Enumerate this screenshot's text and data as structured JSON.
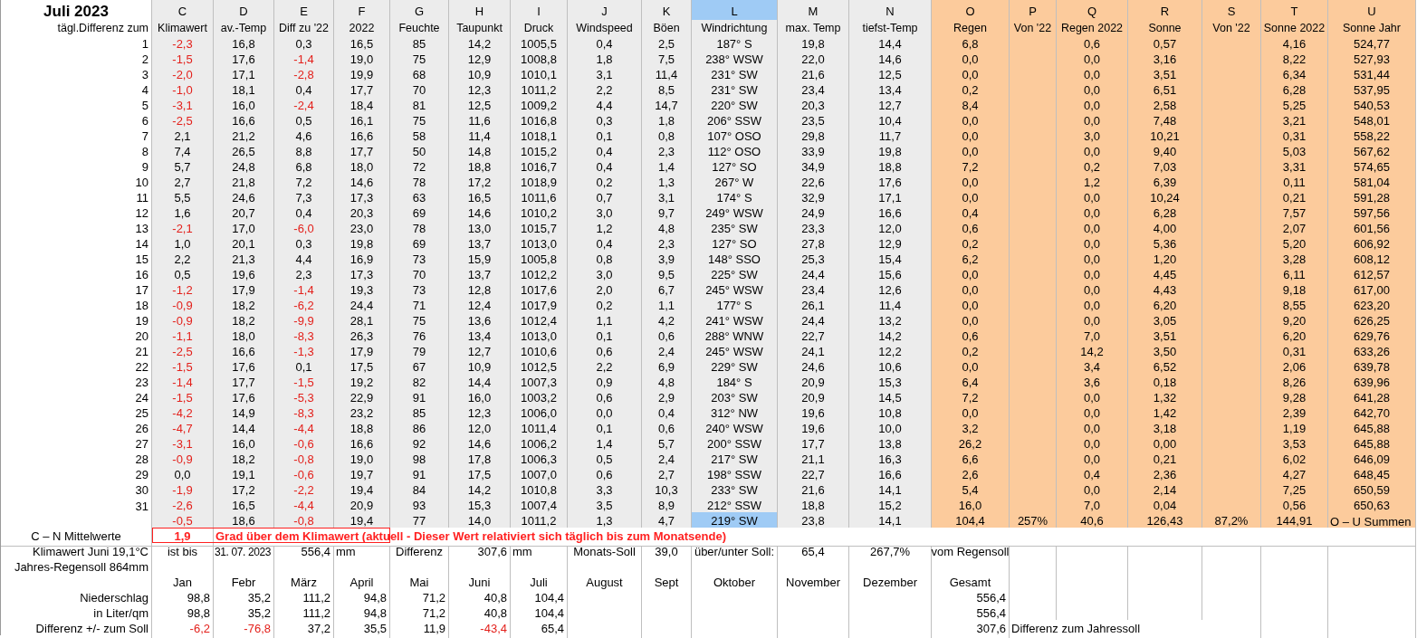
{
  "sheet": {
    "title": "Juli 2023",
    "row_label": "tägl.Differenz zum",
    "columns": [
      {
        "letter": "C",
        "label": "Klimawert",
        "color": "#ececec",
        "selected": false
      },
      {
        "letter": "D",
        "label": "av.-Temp",
        "color": "#ececec",
        "selected": false
      },
      {
        "letter": "E",
        "label": "Diff zu '22",
        "color": "#ececec",
        "selected": false
      },
      {
        "letter": "F",
        "label": "2022",
        "color": "#ececec",
        "selected": false
      },
      {
        "letter": "G",
        "label": "Feuchte",
        "color": "#ececec",
        "selected": false
      },
      {
        "letter": "H",
        "label": "Taupunkt",
        "color": "#ececec",
        "selected": false
      },
      {
        "letter": "I",
        "label": "Druck",
        "color": "#ececec",
        "selected": false
      },
      {
        "letter": "J",
        "label": "Windspeed",
        "color": "#ececec",
        "selected": false
      },
      {
        "letter": "K",
        "label": "Böen",
        "color": "#ececec",
        "selected": false
      },
      {
        "letter": "L",
        "label": "Windrichtung",
        "color": "#ececec",
        "selected": true
      },
      {
        "letter": "M",
        "label": "max. Temp",
        "color": "#ececec",
        "selected": false
      },
      {
        "letter": "N",
        "label": "tiefst-Temp",
        "color": "#ececec",
        "selected": false
      },
      {
        "letter": "O",
        "label": "Regen",
        "color": "#fccb9c",
        "selected": false
      },
      {
        "letter": "P",
        "label": "Von '22",
        "color": "#fccb9c",
        "selected": false
      },
      {
        "letter": "Q",
        "label": "Regen 2022",
        "color": "#fccb9c",
        "selected": false
      },
      {
        "letter": "R",
        "label": "Sonne",
        "color": "#fccb9c",
        "selected": false
      },
      {
        "letter": "S",
        "label": "Von '22",
        "color": "#fccb9c",
        "selected": false
      },
      {
        "letter": "T",
        "label": "Sonne 2022",
        "color": "#fccb9c",
        "selected": false
      },
      {
        "letter": "U",
        "label": "Sonne Jahr",
        "color": "#fccb9c",
        "selected": false
      }
    ],
    "rows": [
      {
        "day": "1",
        "cells": [
          {
            "text": "-2,3",
            "red": true
          },
          "16,8",
          "0,3",
          "16,5",
          "85",
          "14,2",
          "1005,5",
          "0,4",
          "2,5",
          "187° S",
          "19,8",
          "14,4",
          "6,8",
          null,
          "0,6",
          "0,57",
          null,
          "4,16",
          "524,77"
        ]
      },
      {
        "day": "2",
        "cells": [
          {
            "text": "-1,5",
            "red": true
          },
          "17,6",
          {
            "text": "-1,4",
            "red": true
          },
          "19,0",
          "75",
          "12,9",
          "1008,8",
          "1,8",
          "7,5",
          "238° WSW",
          "22,0",
          "14,6",
          "0,0",
          null,
          "0,0",
          "3,16",
          null,
          "8,22",
          "527,93"
        ]
      },
      {
        "day": "3",
        "cells": [
          {
            "text": "-2,0",
            "red": true
          },
          "17,1",
          {
            "text": "-2,8",
            "red": true
          },
          "19,9",
          "68",
          "10,9",
          "1010,1",
          "3,1",
          "11,4",
          "231° SW",
          "21,6",
          "12,5",
          "0,0",
          null,
          "0,0",
          "3,51",
          null,
          "6,34",
          "531,44"
        ]
      },
      {
        "day": "4",
        "cells": [
          {
            "text": "-1,0",
            "red": true
          },
          "18,1",
          "0,4",
          "17,7",
          "70",
          "12,3",
          "1011,2",
          "2,2",
          "8,5",
          "231° SW",
          "23,4",
          "13,4",
          "0,2",
          null,
          "0,0",
          "6,51",
          null,
          "6,28",
          "537,95"
        ]
      },
      {
        "day": "5",
        "cells": [
          {
            "text": "-3,1",
            "red": true
          },
          "16,0",
          {
            "text": "-2,4",
            "red": true
          },
          "18,4",
          "81",
          "12,5",
          "1009,2",
          "4,4",
          "14,7",
          "220° SW",
          "20,3",
          "12,7",
          "8,4",
          null,
          "0,0",
          "2,58",
          null,
          "5,25",
          "540,53"
        ]
      },
      {
        "day": "6",
        "cells": [
          {
            "text": "-2,5",
            "red": true
          },
          "16,6",
          "0,5",
          "16,1",
          "75",
          "11,6",
          "1016,8",
          "0,3",
          "1,8",
          "206° SSW",
          "23,5",
          "10,4",
          "0,0",
          null,
          "0,0",
          "7,48",
          null,
          "3,21",
          "548,01"
        ]
      },
      {
        "day": "7",
        "cells": [
          "2,1",
          "21,2",
          "4,6",
          "16,6",
          "58",
          "11,4",
          "1018,1",
          "0,1",
          "0,8",
          "107° OSO",
          "29,8",
          "11,7",
          "0,0",
          null,
          "3,0",
          "10,21",
          null,
          "0,31",
          "558,22"
        ]
      },
      {
        "day": "8",
        "cells": [
          "7,4",
          "26,5",
          "8,8",
          "17,7",
          "50",
          "14,8",
          "1015,2",
          "0,4",
          "2,3",
          "112° OSO",
          "33,9",
          "19,8",
          "0,0",
          null,
          "0,0",
          "9,40",
          null,
          "5,03",
          "567,62"
        ]
      },
      {
        "day": "9",
        "cells": [
          "5,7",
          "24,8",
          "6,8",
          "18,0",
          "72",
          "18,8",
          "1016,7",
          "0,4",
          "1,4",
          "127° SO",
          "34,9",
          "18,8",
          "7,2",
          null,
          "0,2",
          "7,03",
          null,
          "3,31",
          "574,65"
        ]
      },
      {
        "day": "10",
        "cells": [
          "2,7",
          "21,8",
          "7,2",
          "14,6",
          "78",
          "17,2",
          "1018,9",
          "0,2",
          "1,3",
          "267° W",
          "22,6",
          "17,6",
          "0,0",
          null,
          "1,2",
          "6,39",
          null,
          "0,11",
          "581,04"
        ]
      },
      {
        "day": "11",
        "cells": [
          "5,5",
          "24,6",
          "7,3",
          "17,3",
          "63",
          "16,5",
          "1011,6",
          "0,7",
          "3,1",
          "174° S",
          "32,9",
          "17,1",
          "0,0",
          null,
          "0,0",
          "10,24",
          null,
          "0,21",
          "591,28"
        ]
      },
      {
        "day": "12",
        "cells": [
          "1,6",
          "20,7",
          "0,4",
          "20,3",
          "69",
          "14,6",
          "1010,2",
          "3,0",
          "9,7",
          "249° WSW",
          "24,9",
          "16,6",
          "0,4",
          null,
          "0,0",
          "6,28",
          null,
          "7,57",
          "597,56"
        ]
      },
      {
        "day": "13",
        "cells": [
          {
            "text": "-2,1",
            "red": true
          },
          "17,0",
          {
            "text": "-6,0",
            "red": true
          },
          "23,0",
          "78",
          "13,0",
          "1015,7",
          "1,2",
          "4,8",
          "235° SW",
          "23,3",
          "12,0",
          "0,6",
          null,
          "0,0",
          "4,00",
          null,
          "2,07",
          "601,56"
        ]
      },
      {
        "day": "14",
        "cells": [
          "1,0",
          "20,1",
          "0,3",
          "19,8",
          "69",
          "13,7",
          "1013,0",
          "0,4",
          "2,3",
          "127° SO",
          "27,8",
          "12,9",
          "0,2",
          null,
          "0,0",
          "5,36",
          null,
          "5,20",
          "606,92"
        ]
      },
      {
        "day": "15",
        "cells": [
          "2,2",
          "21,3",
          "4,4",
          "16,9",
          "73",
          "15,9",
          "1005,8",
          "0,8",
          "3,9",
          "148° SSO",
          "25,3",
          "15,4",
          "6,2",
          null,
          "0,0",
          "1,20",
          null,
          "3,28",
          "608,12"
        ]
      },
      {
        "day": "16",
        "cells": [
          "0,5",
          "19,6",
          "2,3",
          "17,3",
          "70",
          "13,7",
          "1012,2",
          "3,0",
          "9,5",
          "225° SW",
          "24,4",
          "15,6",
          "0,0",
          null,
          "0,0",
          "4,45",
          null,
          "6,11",
          "612,57"
        ]
      },
      {
        "day": "17",
        "cells": [
          {
            "text": "-1,2",
            "red": true
          },
          "17,9",
          {
            "text": "-1,4",
            "red": true
          },
          "19,3",
          "73",
          "12,8",
          "1017,6",
          "2,0",
          "6,7",
          "245° WSW",
          "23,4",
          "12,6",
          "0,0",
          null,
          "0,0",
          "4,43",
          null,
          "9,18",
          "617,00"
        ]
      },
      {
        "day": "18",
        "cells": [
          {
            "text": "-0,9",
            "red": true
          },
          "18,2",
          {
            "text": "-6,2",
            "red": true
          },
          "24,4",
          "71",
          "12,4",
          "1017,9",
          "0,2",
          "1,1",
          "177° S",
          "26,1",
          "11,4",
          "0,0",
          null,
          "0,0",
          "6,20",
          null,
          "8,55",
          "623,20"
        ]
      },
      {
        "day": "19",
        "cells": [
          {
            "text": "-0,9",
            "red": true
          },
          "18,2",
          {
            "text": "-9,9",
            "red": true
          },
          "28,1",
          "75",
          "13,6",
          "1012,4",
          "1,1",
          "4,2",
          "241° WSW",
          "24,4",
          "13,2",
          "0,0",
          null,
          "0,0",
          "3,05",
          null,
          "9,20",
          "626,25"
        ]
      },
      {
        "day": "20",
        "cells": [
          {
            "text": "-1,1",
            "red": true
          },
          "18,0",
          {
            "text": "-8,3",
            "red": true
          },
          "26,3",
          "76",
          "13,4",
          "1013,0",
          "0,1",
          "0,6",
          "288° WNW",
          "22,7",
          "14,2",
          "0,6",
          null,
          "7,0",
          "3,51",
          null,
          "6,20",
          "629,76"
        ]
      },
      {
        "day": "21",
        "cells": [
          {
            "text": "-2,5",
            "red": true
          },
          "16,6",
          {
            "text": "-1,3",
            "red": true
          },
          "17,9",
          "79",
          "12,7",
          "1010,6",
          "0,6",
          "2,4",
          "245° WSW",
          "24,1",
          "12,2",
          "0,2",
          null,
          "14,2",
          "3,50",
          null,
          "0,31",
          "633,26"
        ]
      },
      {
        "day": "22",
        "cells": [
          {
            "text": "-1,5",
            "red": true
          },
          "17,6",
          "0,1",
          "17,5",
          "67",
          "10,9",
          "1012,5",
          "2,2",
          "6,9",
          "229° SW",
          "24,6",
          "10,6",
          "0,0",
          null,
          "3,4",
          "6,52",
          null,
          "2,06",
          "639,78"
        ]
      },
      {
        "day": "23",
        "cells": [
          {
            "text": "-1,4",
            "red": true
          },
          "17,7",
          {
            "text": "-1,5",
            "red": true
          },
          "19,2",
          "82",
          "14,4",
          "1007,3",
          "0,9",
          "4,8",
          "184° S",
          "20,9",
          "15,3",
          "6,4",
          null,
          "3,6",
          "0,18",
          null,
          "8,26",
          "639,96"
        ]
      },
      {
        "day": "24",
        "cells": [
          {
            "text": "-1,5",
            "red": true
          },
          "17,6",
          {
            "text": "-5,3",
            "red": true
          },
          "22,9",
          "91",
          "16,0",
          "1003,2",
          "0,6",
          "2,9",
          "203° SW",
          "20,9",
          "14,5",
          "7,2",
          null,
          "0,0",
          "1,32",
          null,
          "9,28",
          "641,28"
        ]
      },
      {
        "day": "25",
        "cells": [
          {
            "text": "-4,2",
            "red": true
          },
          "14,9",
          {
            "text": "-8,3",
            "red": true
          },
          "23,2",
          "85",
          "12,3",
          "1006,0",
          "0,0",
          "0,4",
          "312° NW",
          "19,6",
          "10,8",
          "0,0",
          null,
          "0,0",
          "1,42",
          null,
          "2,39",
          "642,70"
        ]
      },
      {
        "day": "26",
        "cells": [
          {
            "text": "-4,7",
            "red": true
          },
          "14,4",
          {
            "text": "-4,4",
            "red": true
          },
          "18,8",
          "86",
          "12,0",
          "1011,4",
          "0,1",
          "0,6",
          "240° WSW",
          "19,6",
          "10,0",
          "3,2",
          null,
          "0,0",
          "3,18",
          null,
          "1,19",
          "645,88"
        ]
      },
      {
        "day": "27",
        "cells": [
          {
            "text": "-3,1",
            "red": true
          },
          "16,0",
          {
            "text": "-0,6",
            "red": true
          },
          "16,6",
          "92",
          "14,6",
          "1006,2",
          "1,4",
          "5,7",
          "200° SSW",
          "17,7",
          "13,8",
          "26,2",
          null,
          "0,0",
          "0,00",
          null,
          "3,53",
          "645,88"
        ]
      },
      {
        "day": "28",
        "cells": [
          {
            "text": "-0,9",
            "red": true
          },
          "18,2",
          {
            "text": "-0,8",
            "red": true
          },
          "19,0",
          "98",
          "17,8",
          "1006,3",
          "0,5",
          "2,4",
          "217° SW",
          "21,1",
          "16,3",
          "6,6",
          null,
          "0,0",
          "0,21",
          null,
          "6,02",
          "646,09"
        ]
      },
      {
        "day": "29",
        "cells": [
          "0,0",
          "19,1",
          {
            "text": "-0,6",
            "red": true
          },
          "19,7",
          "91",
          "17,5",
          "1007,0",
          "0,6",
          "2,7",
          "198° SSW",
          "22,7",
          "16,6",
          "2,6",
          null,
          "0,4",
          "2,36",
          null,
          "4,27",
          "648,45"
        ]
      },
      {
        "day": "30",
        "cells": [
          {
            "text": "-1,9",
            "red": true
          },
          "17,2",
          {
            "text": "-2,2",
            "red": true
          },
          "19,4",
          "84",
          "14,2",
          "1010,8",
          "3,3",
          "10,3",
          "233° SW",
          "21,6",
          "14,1",
          "5,4",
          null,
          "0,0",
          "2,14",
          null,
          "7,25",
          "650,59"
        ]
      },
      {
        "day": "31",
        "cells": [
          {
            "text": "-2,6",
            "red": true
          },
          "16,5",
          {
            "text": "-4,4",
            "red": true
          },
          "20,9",
          "93",
          "15,3",
          "1007,4",
          "3,5",
          "8,9",
          "212° SSW",
          "18,8",
          "15,2",
          "16,0",
          null,
          "7,0",
          "0,04",
          null,
          "0,56",
          "650,63"
        ]
      }
    ],
    "summary": {
      "cells": [
        {
          "text": "-0,5",
          "red": true
        },
        "18,6",
        {
          "text": "-0,8",
          "red": true
        },
        "19,4",
        "77",
        "14,0",
        "1011,2",
        "1,3",
        "4,7",
        "219° SW",
        "23,8",
        "14,1",
        "104,4",
        "257%",
        "40,6",
        "126,43",
        "87,2%",
        "144,91",
        "O – U Summen"
      ]
    }
  },
  "bottom": {
    "mean_row": {
      "label": "C – N Mittelwerte",
      "value": "1,9",
      "note": "Grad über dem Klimawert (aktuell - Dieser Wert relativiert sich täglich bis zum Monatsende)"
    },
    "climate_row": {
      "label": "Klimawert Juni 19,1°C",
      "cells": [
        "ist bis",
        "31. 07. 2023",
        "556,4",
        "mm",
        "Differenz",
        "307,6",
        "mm",
        "Monats-Soll",
        "39,0",
        "über/unter Soll:",
        "65,4",
        "267,7%",
        "vom Regensoll"
      ]
    },
    "annual_row": {
      "label": "Jahres-Regensoll 864mm"
    },
    "months": [
      "Jan",
      "Febr",
      "März",
      "April",
      "Mai",
      "Juni",
      "Juli",
      "August",
      "Sept",
      "Oktober",
      "November",
      "Dezember",
      "Gesamt"
    ],
    "precip_rows": [
      {
        "label": "Niederschlag",
        "values": [
          "98,8",
          "35,2",
          "111,2",
          "94,8",
          "71,2",
          "40,8",
          "104,4"
        ],
        "total": "556,4"
      },
      {
        "label": "in Liter/qm",
        "values": [
          "98,8",
          "35,2",
          "111,2",
          "94,8",
          "71,2",
          "40,8",
          "104,4"
        ],
        "total": "556,4"
      },
      {
        "label": "Differenz +/- zum Soll",
        "values": [
          {
            "text": "-6,2",
            "red": true
          },
          {
            "text": "-76,8",
            "red": true
          },
          "37,2",
          "35,5",
          "11,9",
          {
            "text": "-43,4",
            "red": true
          },
          "65,4"
        ],
        "total": "307,6",
        "note": "Differenz zum Jahressoll"
      }
    ]
  }
}
